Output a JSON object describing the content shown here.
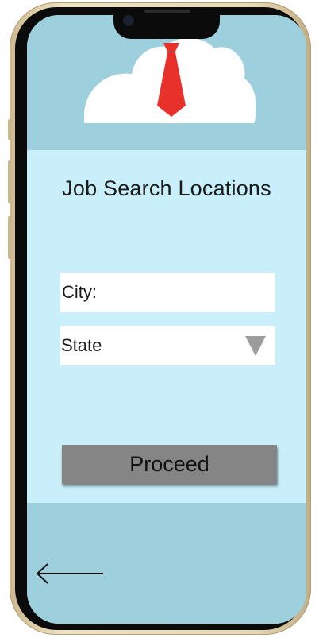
{
  "app": {
    "logo_icon": "cloud-with-necktie-icon",
    "colors": {
      "header_band": "#9ecfdc",
      "content_background": "#c9f0fa",
      "input_background": "#ffffff",
      "button_background": "#858585",
      "tie_red": "#e8312a",
      "frame_gold": "#e7d7b2"
    }
  },
  "main": {
    "title": "Job Search Locations",
    "city_field": {
      "label": "City:"
    },
    "state_select": {
      "selected": "State",
      "icon": "dropdown-triangle-icon"
    },
    "proceed_label": "Proceed"
  },
  "footer": {
    "back_icon": "left-arrow-icon"
  }
}
